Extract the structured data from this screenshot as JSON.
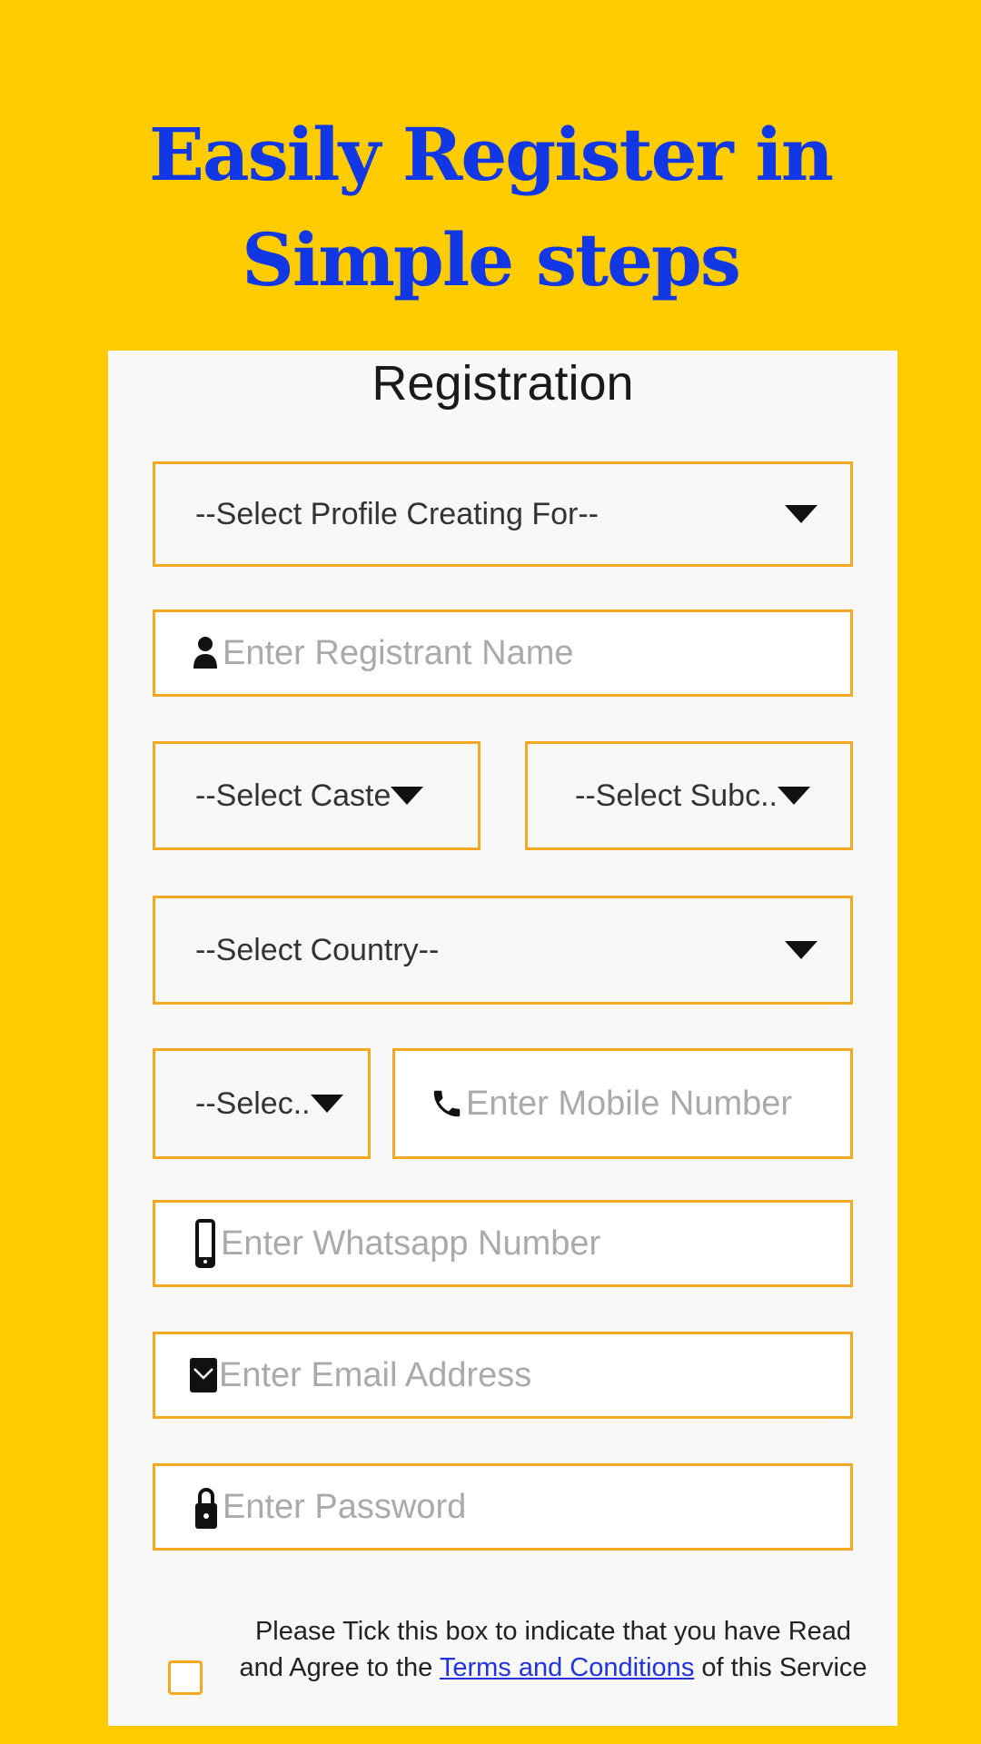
{
  "headline": {
    "line1": "Easily Register in",
    "line2": "Simple steps"
  },
  "form": {
    "title": "Registration",
    "profile_for": {
      "selected": "--Select Profile Creating For--"
    },
    "registrant_name": {
      "placeholder": "Enter Registrant Name",
      "icon": "person-icon"
    },
    "caste": {
      "selected": "--Select Caste"
    },
    "subcaste": {
      "selected": "--Select Subc.."
    },
    "country": {
      "selected": "--Select Country--"
    },
    "country_code": {
      "selected": "--Selec.."
    },
    "mobile": {
      "placeholder": "Enter Mobile Number",
      "icon": "phone-icon"
    },
    "whatsapp": {
      "placeholder": "Enter Whatsapp Number",
      "icon": "smartphone-icon"
    },
    "email": {
      "placeholder": "Enter Email Address",
      "icon": "mail-icon"
    },
    "password": {
      "placeholder": "Enter Password",
      "icon": "lock-icon"
    },
    "terms": {
      "checked": false,
      "text_before": "Please Tick this box to indicate that you have Read and Agree to the ",
      "link_text": "Terms and Conditions",
      "text_after": " of this Service"
    }
  },
  "colors": {
    "background": "#FFCC00",
    "headline": "#1238E6",
    "field_border": "#F7A823",
    "link": "#2233DD"
  }
}
